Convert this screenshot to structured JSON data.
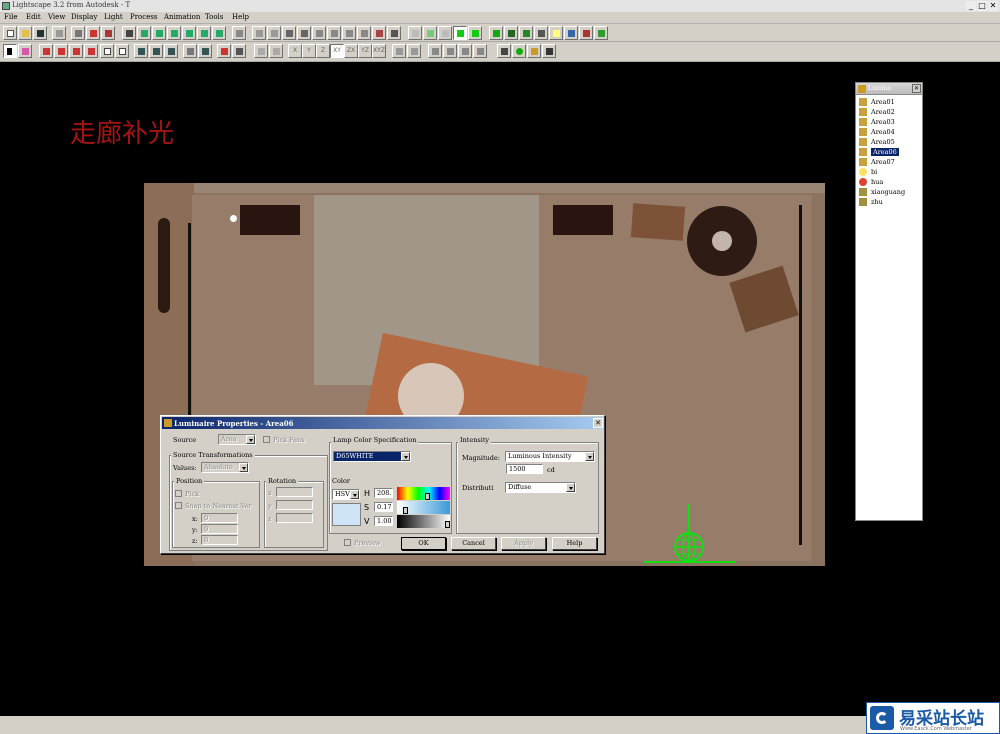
{
  "app": {
    "title": "Lightscape 3.2 from Autodesk - T"
  },
  "window_controls": {
    "minimize": "_",
    "maximize": "□",
    "close": "✕"
  },
  "menu": [
    "File",
    "Edit",
    "View",
    "Display",
    "Light",
    "Process",
    "Animation",
    "Tools",
    "Help"
  ],
  "annotation": "走廊补光",
  "luminaires_window": {
    "title": "Lumina",
    "close": "✕",
    "items": [
      "Area01",
      "Area02",
      "Area03",
      "Area04",
      "Area05",
      "Area06",
      "Area07",
      "bi",
      "hua",
      "xiaoguang",
      "zhu"
    ],
    "selected": "Area06"
  },
  "dialog": {
    "title": "Luminaire Properties - Area06",
    "close": "✕",
    "source_label": "Source",
    "source_value": "Area",
    "pick_fans_label": "Pick Fans",
    "source_transformations_label": "Source Transformations",
    "values_label": "Values:",
    "values_value": "Absolute",
    "position_label": "Position",
    "pick_label": "Pick",
    "snap_label": "Snap to Nearest Ver",
    "x_label": "x:",
    "x_value": "0",
    "y_label": "y:",
    "y_value": "0",
    "z_label": "z:",
    "z_value": "0",
    "rotation_label": "Rotation",
    "rx_label": "x",
    "ry_label": "y",
    "rz_label": "z",
    "lamp_color_label": "Lamp Color Specification",
    "lamp_color_value": "D65WHITE",
    "color_label": "Color",
    "color_model": "HSV",
    "h_label": "H",
    "h_value": "208.",
    "s_label": "S",
    "s_value": "0.17",
    "v_label": "V",
    "v_value": "1.00",
    "swatch_color": "#cfe4f7",
    "preview_label": "Preview",
    "intensity_label": "Intensity",
    "magnitude_label": "Magnitude:",
    "magnitude_value": "Luminous Intensity",
    "intensity_value": "1500",
    "intensity_unit": "cd",
    "distribution_label": "Distributi",
    "distribution_value": "Diffuse",
    "ok": "OK",
    "cancel": "Cancel",
    "apply": "Apply",
    "help": "Help"
  },
  "toolbar2_axes": [
    "X",
    "Y",
    "Z",
    "XY",
    "ZX",
    "YZ",
    "XYZ"
  ],
  "watermark": {
    "name": "易采站长站",
    "url": "Www.Easck.Com Webmaster"
  }
}
